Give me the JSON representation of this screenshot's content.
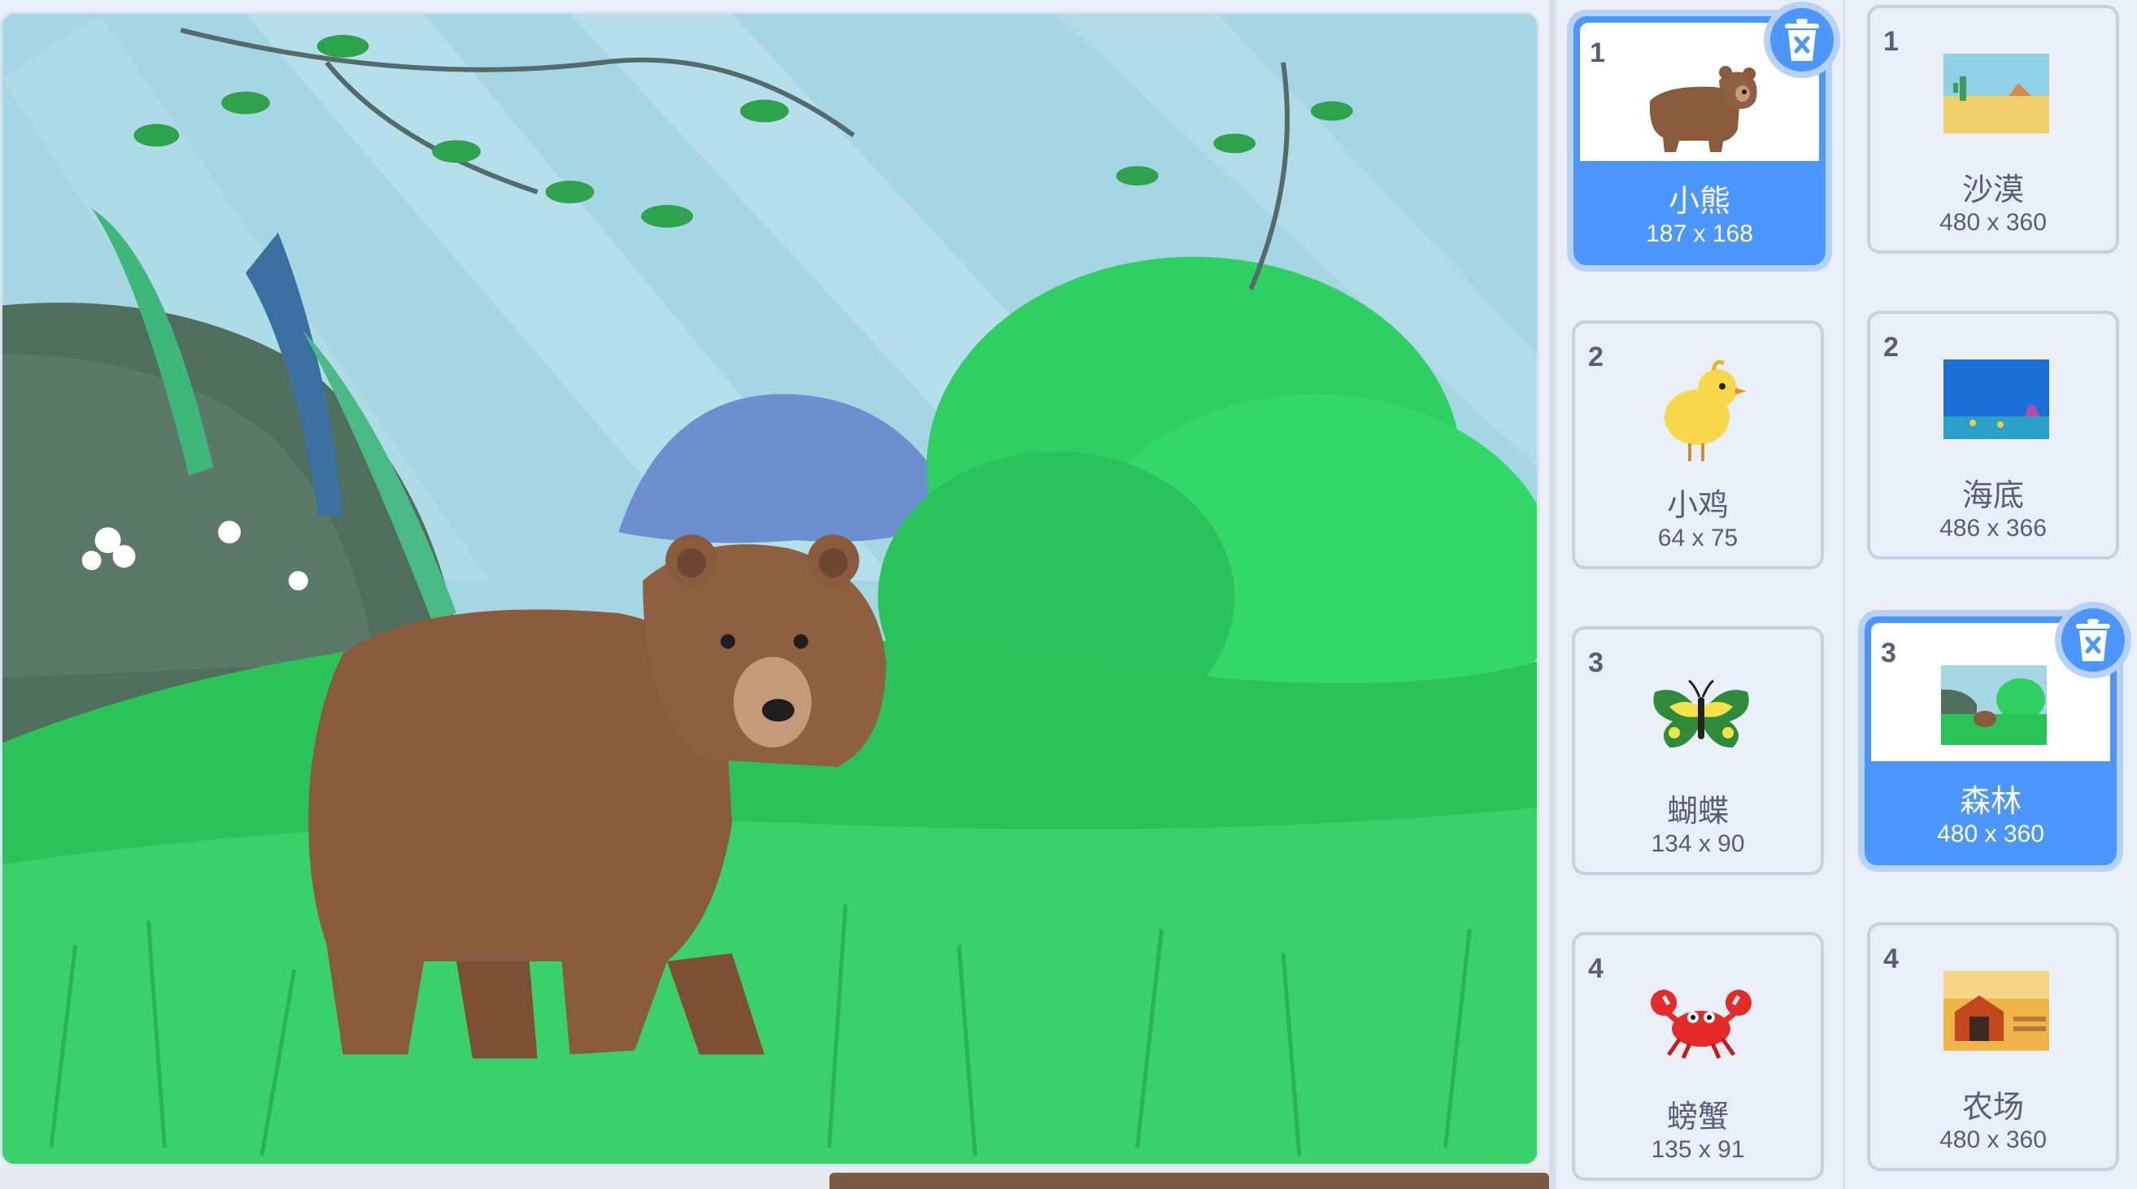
{
  "sprites": [
    {
      "index": "1",
      "name": "小熊",
      "size": "187 x 168",
      "icon": "bear-icon",
      "selected": true
    },
    {
      "index": "2",
      "name": "小鸡",
      "size": "64 x 75",
      "icon": "chick-icon",
      "selected": false
    },
    {
      "index": "3",
      "name": "蝴蝶",
      "size": "134 x 90",
      "icon": "butterfly-icon",
      "selected": false
    },
    {
      "index": "4",
      "name": "螃蟹",
      "size": "135 x 91",
      "icon": "crab-icon",
      "selected": false
    }
  ],
  "backdrops": [
    {
      "index": "1",
      "name": "沙漠",
      "size": "480 x 360",
      "icon": "desert-thumbnail",
      "selected": false
    },
    {
      "index": "2",
      "name": "海底",
      "size": "486 x 366",
      "icon": "underwater-thumbnail",
      "selected": false
    },
    {
      "index": "3",
      "name": "森林",
      "size": "480 x 360",
      "icon": "forest-thumbnail",
      "selected": true
    },
    {
      "index": "4",
      "name": "农场",
      "size": "480 x 360",
      "icon": "farm-thumbnail",
      "selected": false
    }
  ],
  "colors": {
    "accent": "#4c97ff",
    "accent_halo": "#b6d2fb",
    "text": "#575e75",
    "panel": "#e9eef7"
  }
}
